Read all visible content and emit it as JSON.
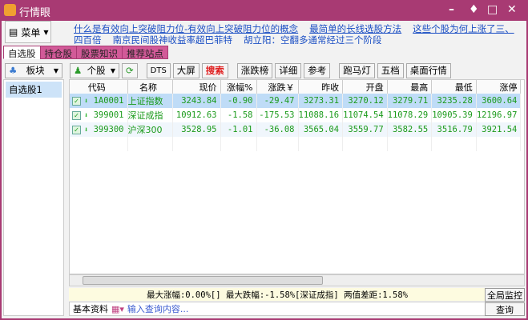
{
  "window": {
    "title": "行情眼",
    "controls": [
      "minimize",
      "skin",
      "maximize",
      "close"
    ]
  },
  "menu": {
    "label": "菜单"
  },
  "news": [
    "什么是有效向上突破阻力位-有效向上突破阻力位的概念",
    "最简单的长线选股方法",
    "这些个股为何上涨了三、四百倍",
    "南京民间股神收益率超巴菲特",
    "胡立阳：空翻多通常经过三个阶段"
  ],
  "tabs": [
    "自选股",
    "持仓股",
    "股票知识",
    "推荐站点"
  ],
  "toolbar": {
    "sector": "板块",
    "stock": "个股",
    "buttons": [
      "DTS",
      "大屏",
      "搜索",
      "涨跌榜",
      "详细",
      "参考",
      "跑马灯",
      "五档",
      "桌面行情"
    ]
  },
  "sidebar": {
    "items": [
      "自选股1"
    ]
  },
  "table": {
    "headers": [
      "代码",
      "名称",
      "现价",
      "涨幅%",
      "涨跌￥",
      "昨收",
      "开盘",
      "最高",
      "最低",
      "涨停"
    ],
    "rows": [
      [
        "1A0001",
        "上证指数",
        "3243.84",
        "-0.90",
        "-29.47",
        "3273.31",
        "3270.12",
        "3279.71",
        "3235.28",
        "3600.64"
      ],
      [
        "399001",
        "深证成指",
        "10912.63",
        "-1.58",
        "-175.53",
        "11088.16",
        "11074.54",
        "11078.29",
        "10905.39",
        "12196.97"
      ],
      [
        "399300",
        "沪深300",
        "3528.95",
        "-1.01",
        "-36.08",
        "3565.04",
        "3559.77",
        "3582.55",
        "3516.79",
        "3921.54"
      ]
    ]
  },
  "status": {
    "text": "最大涨幅:0.00%[]   最大跌幅:-1.58%[深证成指]   两值差距:1.58%",
    "monitor": "全局监控"
  },
  "bottom": {
    "label": "基本资料",
    "placeholder": "输入查询内容...",
    "query": "查询"
  },
  "colors": {
    "titlebar": "#a83a73",
    "down": "#1a9a1a",
    "search": "#e02020"
  }
}
